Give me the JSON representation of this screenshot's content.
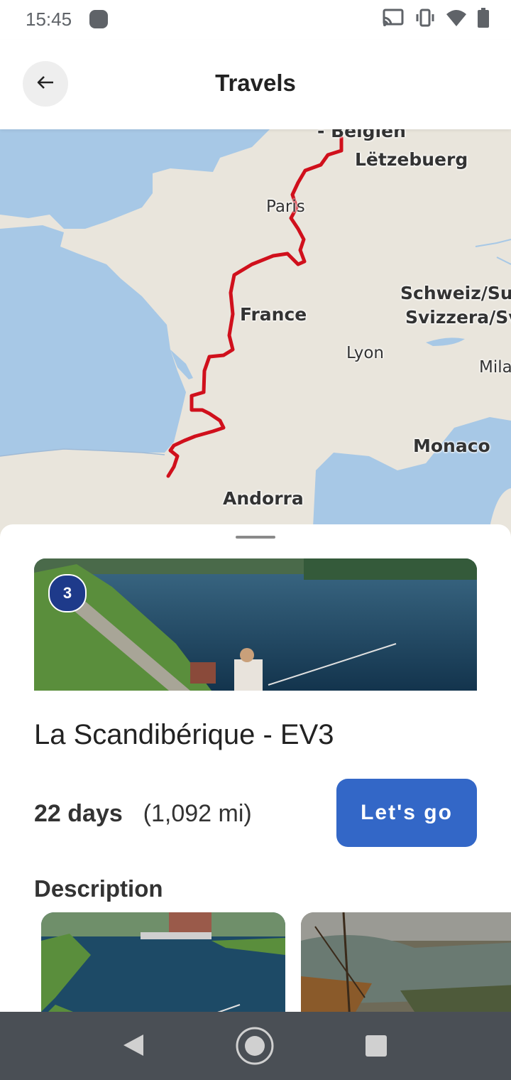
{
  "status_bar": {
    "time": "15:45"
  },
  "app_bar": {
    "title": "Travels"
  },
  "map": {
    "labels": {
      "belgien": "- Belgien",
      "luxembourg": "Lëtzebuerg",
      "paris": "Paris",
      "switzerland_1": "Schweiz/Sui",
      "switzerland_2": "Svizzera/Sv",
      "france": "France",
      "lyon": "Lyon",
      "milan": "Mila",
      "monaco": "Monaco",
      "andorra": "Andorra"
    },
    "colors": {
      "land": "#e9e5dc",
      "water": "#a7c8e6",
      "route": "#d0101c"
    }
  },
  "route": {
    "badge_number": "3",
    "title": "La Scandibérique - EV3",
    "duration_days": "22 days",
    "distance": "(1,092 mi)",
    "cta_label": "Let's go",
    "description_heading": "Description"
  },
  "colors": {
    "accent": "#3367c7",
    "nav_bar": "#4a4f55"
  }
}
